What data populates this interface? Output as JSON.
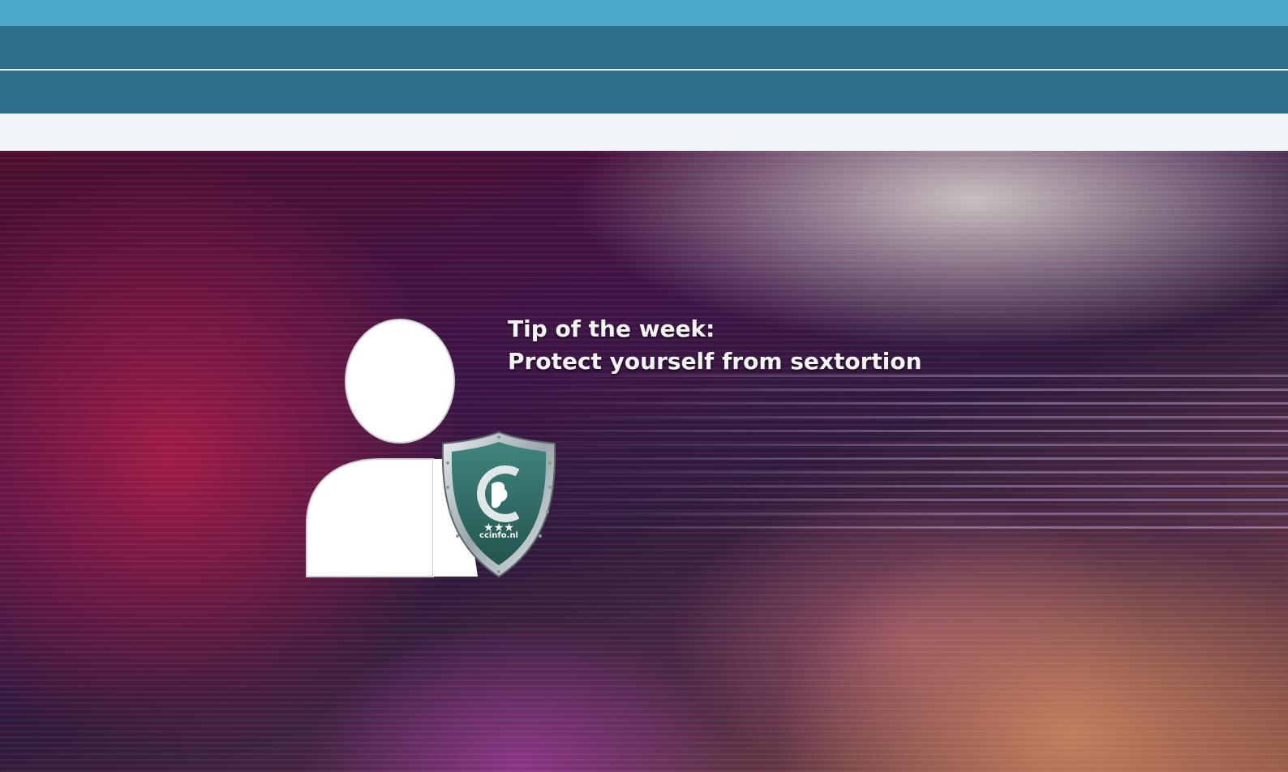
{
  "header": {
    "topbar_color": "#4ba9cb",
    "navbar_color": "#2b6f8b",
    "subbar_color": "#f1f4f6"
  },
  "hero": {
    "headline_line1": "Tip of the week:",
    "headline_line2": "Protect yourself from sextortion",
    "person_icon": "user-icon",
    "shield_icon": "shield-badge-icon",
    "shield_label": "ccinfo.nl"
  }
}
